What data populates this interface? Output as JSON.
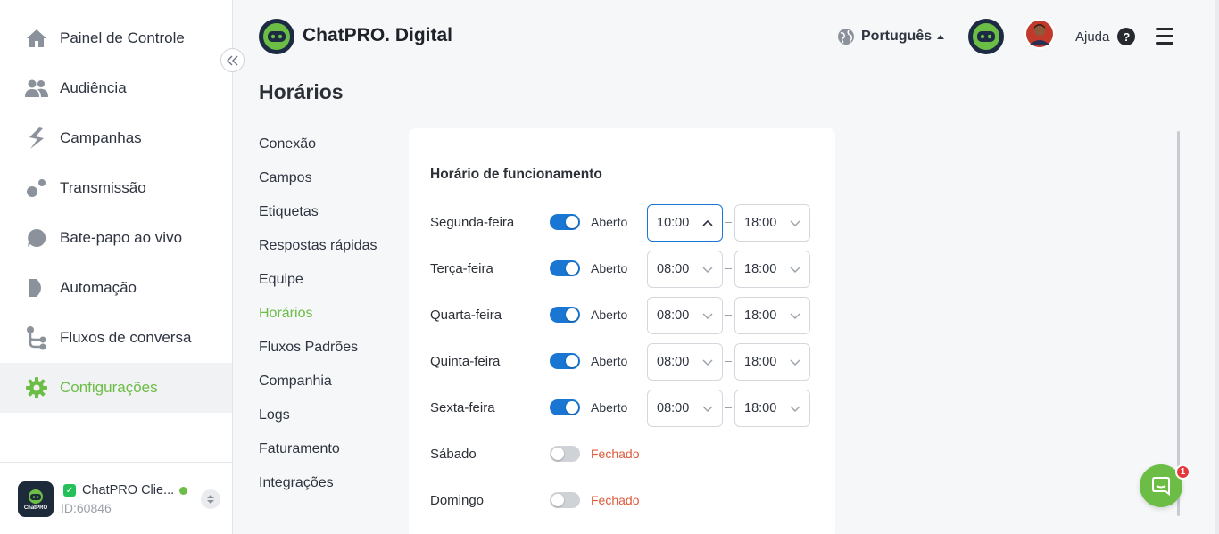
{
  "sidebar": {
    "items": [
      {
        "label": "Painel de Controle",
        "icon": "home-icon"
      },
      {
        "label": "Audiência",
        "icon": "users-icon"
      },
      {
        "label": "Campanhas",
        "icon": "campaigns-icon"
      },
      {
        "label": "Transmissão",
        "icon": "broadcast-icon"
      },
      {
        "label": "Bate-papo ao vivo",
        "icon": "chat-bubble-icon"
      },
      {
        "label": "Automação",
        "icon": "play-icon"
      },
      {
        "label": "Fluxos de conversa",
        "icon": "flow-icon"
      },
      {
        "label": "Configurações",
        "icon": "gear-icon",
        "active": true
      }
    ],
    "instance": {
      "name": "ChatPRO Clie...",
      "id": "ID:60846",
      "logo_text": "ChatPRO"
    }
  },
  "header": {
    "brand": "ChatPRO. Digital",
    "language": "Português",
    "help": "Ajuda",
    "help_symbol": "?"
  },
  "page": {
    "title": "Horários"
  },
  "submenu": [
    {
      "label": "Conexão"
    },
    {
      "label": "Campos"
    },
    {
      "label": "Etiquetas"
    },
    {
      "label": "Respostas rápidas"
    },
    {
      "label": "Equipe"
    },
    {
      "label": "Horários",
      "active": true
    },
    {
      "label": "Fluxos Padrões"
    },
    {
      "label": "Companhia"
    },
    {
      "label": "Logs"
    },
    {
      "label": "Faturamento"
    },
    {
      "label": "Integrações"
    }
  ],
  "schedule": {
    "title": "Horário de funcionamento",
    "days": [
      {
        "name": "Segunda-feira",
        "enabled": true,
        "status": "Aberto",
        "from": "10:00",
        "to": "18:00",
        "from_open": true
      },
      {
        "name": "Terça-feira",
        "enabled": true,
        "status": "Aberto",
        "from": "08:00",
        "to": "18:00"
      },
      {
        "name": "Quarta-feira",
        "enabled": true,
        "status": "Aberto",
        "from": "08:00",
        "to": "18:00"
      },
      {
        "name": "Quinta-feira",
        "enabled": true,
        "status": "Aberto",
        "from": "08:00",
        "to": "18:00"
      },
      {
        "name": "Sexta-feira",
        "enabled": true,
        "status": "Aberto",
        "from": "08:00",
        "to": "18:00"
      },
      {
        "name": "Sábado",
        "enabled": false,
        "status": "Fechado"
      },
      {
        "name": "Domingo",
        "enabled": false,
        "status": "Fechado"
      }
    ]
  },
  "chat_widget": {
    "badge": "1"
  },
  "colors": {
    "accent_green": "#6cbd45",
    "toggle_blue": "#1976d2",
    "closed_red": "#e05a3a"
  }
}
